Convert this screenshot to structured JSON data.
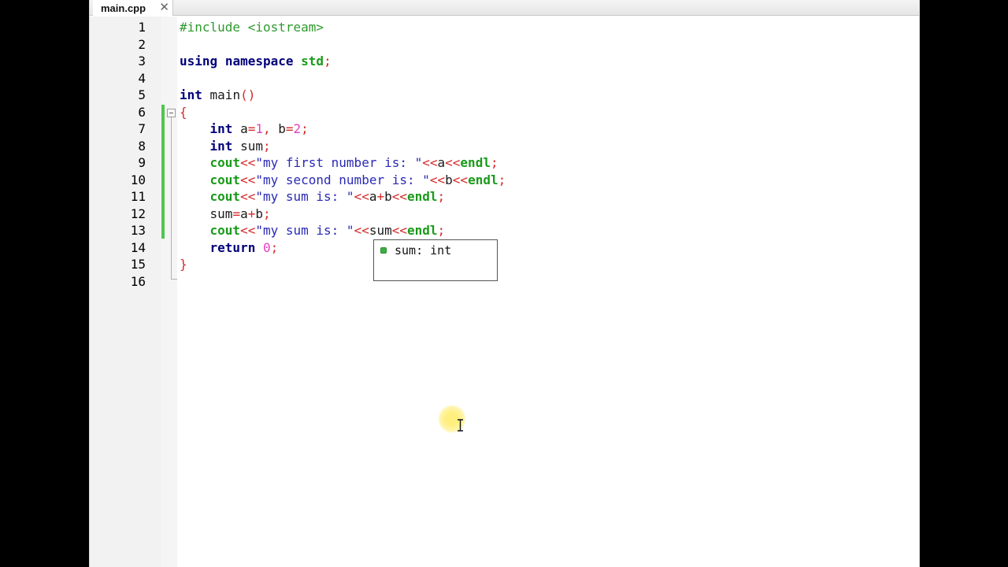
{
  "tab": {
    "title": "main.cpp",
    "close_glyph": "✕"
  },
  "line_numbers": [
    "1",
    "2",
    "3",
    "4",
    "5",
    "6",
    "7",
    "8",
    "9",
    "10",
    "11",
    "12",
    "13",
    "14",
    "15",
    "16"
  ],
  "code": {
    "l1": {
      "pp": "#include <iostream>"
    },
    "l3": {
      "kw1": "using",
      "sp1": " ",
      "kw2": "namespace",
      "sp2": " ",
      "ns": "std",
      "op": ";"
    },
    "l5": {
      "kw": "int",
      "id": " main",
      "op": "()"
    },
    "l6": {
      "op": "{"
    },
    "l7": {
      "ind": "    ",
      "kw": "int",
      "a": " a",
      "eq1": "=",
      "n1": "1",
      "c": ",",
      "b": " b",
      "eq2": "=",
      "n2": "2",
      "semi": ";"
    },
    "l8": {
      "ind": "    ",
      "kw": "int",
      "id": " sum",
      "semi": ";"
    },
    "l9": {
      "ind": "    ",
      "cout": "cout",
      "op1": "<<",
      "str": "\"my first number is: \"",
      "op2": "<<",
      "id": "a",
      "op3": "<<",
      "endl": "endl",
      "semi": ";"
    },
    "l10": {
      "ind": "    ",
      "cout": "cout",
      "op1": "<<",
      "str": "\"my second number is: \"",
      "op2": "<<",
      "id": "b",
      "op3": "<<",
      "endl": "endl",
      "semi": ";"
    },
    "l11": {
      "ind": "    ",
      "cout": "cout",
      "op1": "<<",
      "str": "\"my sum is: \"",
      "op2": "<<",
      "id1": "a",
      "plus": "+",
      "id2": "b",
      "op3": "<<",
      "endl": "endl",
      "semi": ";"
    },
    "l12": {
      "ind": "    ",
      "id1": "sum",
      "eq": "=",
      "id2": "a",
      "plus": "+",
      "id3": "b",
      "semi": ";"
    },
    "l13": {
      "ind": "    ",
      "cout": "cout",
      "op1": "<<",
      "str": "\"my sum is: \"",
      "op2": "<<",
      "id": "sum",
      "op3": "<<",
      "endl": "endl",
      "semi": ";"
    },
    "l14": {
      "ind": "    ",
      "kw": "return",
      "sp": " ",
      "num": "0",
      "semi": ";"
    },
    "l15": {
      "op": "}"
    }
  },
  "autocomplete": {
    "item": "sum: int"
  },
  "colors": {
    "keyword": "#00007a",
    "preprocessor": "#2f9a2f",
    "namespace": "#1a9a1a",
    "operator": "#d42a2a",
    "number": "#e040c0",
    "string": "#2a2ab5",
    "change_marker": "#4ec64e"
  },
  "icons": {
    "fold": "fold-minus-icon",
    "completion": "variable-icon",
    "cursor": "ibeam-cursor-icon"
  }
}
